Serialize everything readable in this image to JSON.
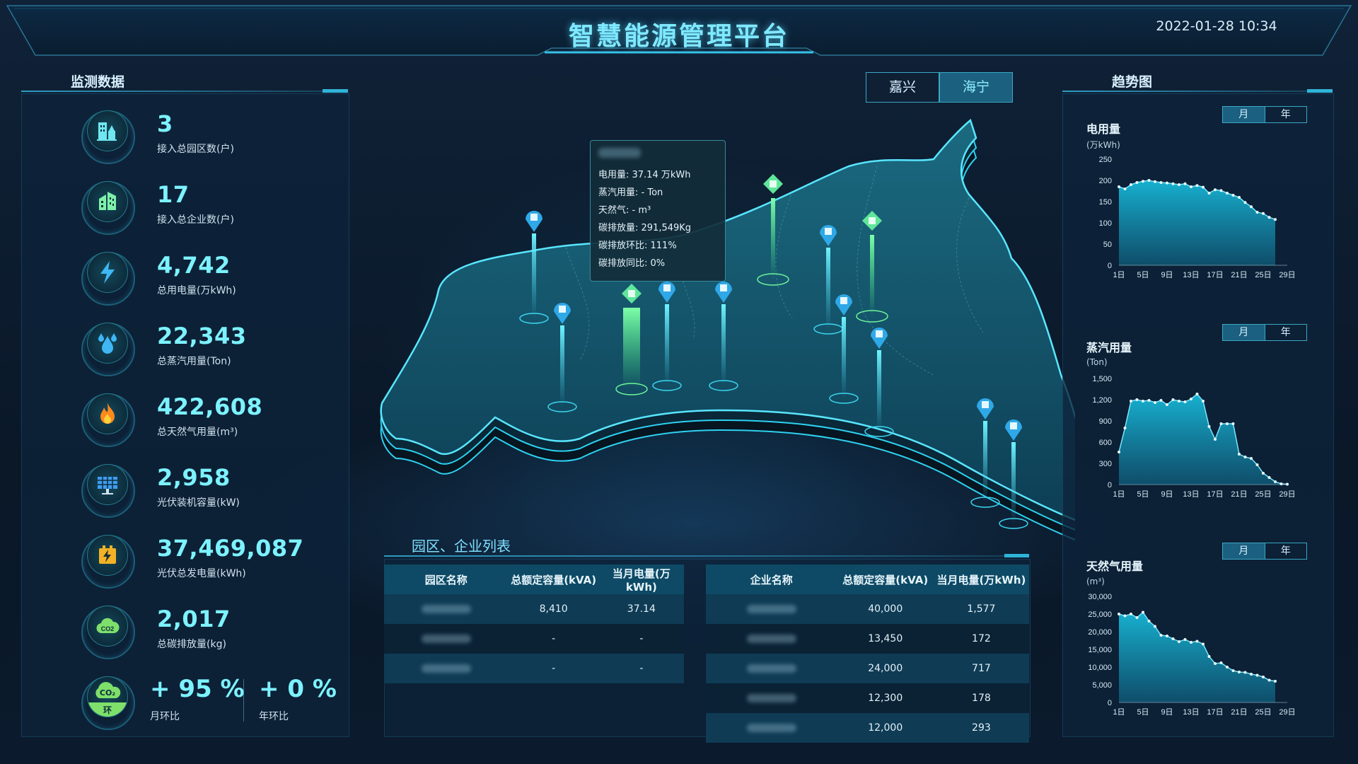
{
  "header": {
    "title": "智慧能源管理平台",
    "datetime": "2022-01-28 10:34"
  },
  "left_panel": {
    "title": "监测数据",
    "metrics": [
      {
        "value": "3",
        "label": "接入总园区数(户)",
        "icon": "building-icon"
      },
      {
        "value": "17",
        "label": "接入总企业数(户)",
        "icon": "enterprise-icon"
      },
      {
        "value": "4,742",
        "label": "总用电量(万kWh)",
        "icon": "lightning-icon"
      },
      {
        "value": "22,343",
        "label": "总蒸汽用量(Ton)",
        "icon": "water-drop-icon"
      },
      {
        "value": "422,608",
        "label": "总天然气用量(m³)",
        "icon": "flame-icon"
      },
      {
        "value": "2,958",
        "label": "光伏装机容量(kW)",
        "icon": "solar-panel-icon"
      },
      {
        "value": "37,469,087",
        "label": "光伏总发电量(kWh)",
        "icon": "battery-charge-icon"
      },
      {
        "value": "2,017",
        "label": "总碳排放量(kg)",
        "icon": "co2-cloud-icon"
      }
    ],
    "ratios": {
      "icon_text_top": "CO₂",
      "icon_text_bottom": "环",
      "month_value": "+ 95 %",
      "month_label": "月环比",
      "year_value": "+ 0 %",
      "year_label": "年环比"
    }
  },
  "map": {
    "cities": [
      {
        "label": "嘉兴",
        "active": false
      },
      {
        "label": "海宁",
        "active": true
      }
    ],
    "tooltip": {
      "lines": [
        "电用量: 37.14 万kWh",
        "蒸汽用量: - Ton",
        "天然气: - m³",
        "碳排放量: 291,549Kg",
        "碳排放环比: 111%",
        "碳排放同比: 0%"
      ]
    }
  },
  "list": {
    "title": "园区、企业列表",
    "park_table": {
      "headers": [
        "园区名称",
        "总额定容量(kVA)",
        "当月电量(万kWh)"
      ],
      "rows": [
        [
          "",
          "8,410",
          "37.14"
        ],
        [
          "",
          "-",
          "-"
        ],
        [
          "",
          "-",
          "-"
        ]
      ]
    },
    "enterprise_table": {
      "headers": [
        "企业名称",
        "总额定容量(kVA)",
        "当月电量(万kWh)"
      ],
      "rows": [
        [
          "",
          "40,000",
          "1,577"
        ],
        [
          "",
          "13,450",
          "172"
        ],
        [
          "",
          "24,000",
          "717"
        ],
        [
          "",
          "12,300",
          "178"
        ],
        [
          "",
          "12,000",
          "293"
        ]
      ]
    }
  },
  "right_panel": {
    "title": "趋势图",
    "month_label": "月",
    "year_label": "年",
    "charts": [
      {
        "title": "电用量",
        "unit": "(万kWh)",
        "y_ticks": [
          "250",
          "200",
          "150",
          "100",
          "50",
          "0"
        ],
        "x_ticks": [
          "1日",
          "5日",
          "9日",
          "13日",
          "17日",
          "21日",
          "25日",
          "29日"
        ]
      },
      {
        "title": "蒸汽用量",
        "unit": "(Ton)",
        "y_ticks": [
          "1,500",
          "1,200",
          "900",
          "600",
          "300",
          "0"
        ],
        "x_ticks": [
          "1日",
          "5日",
          "9日",
          "13日",
          "17日",
          "21日",
          "25日",
          "29日"
        ]
      },
      {
        "title": "天然气用量",
        "unit": "(m³)",
        "y_ticks": [
          "30,000",
          "25,000",
          "20,000",
          "15,000",
          "10,000",
          "5,000",
          "0"
        ],
        "x_ticks": [
          "1日",
          "5日",
          "9日",
          "13日",
          "17日",
          "21日",
          "25日",
          "29日"
        ]
      }
    ]
  },
  "chart_data": [
    {
      "type": "area",
      "title": "电用量",
      "ylabel": "(万kWh)",
      "x": [
        1,
        2,
        3,
        4,
        5,
        6,
        7,
        8,
        9,
        10,
        11,
        12,
        13,
        14,
        15,
        16,
        17,
        18,
        19,
        20,
        21,
        22,
        23,
        24,
        25,
        26,
        27
      ],
      "values": [
        185,
        180,
        190,
        195,
        198,
        200,
        197,
        195,
        194,
        192,
        190,
        192,
        185,
        188,
        184,
        170,
        178,
        176,
        170,
        165,
        160,
        148,
        138,
        125,
        122,
        113,
        108
      ],
      "ylim": [
        0,
        250
      ]
    },
    {
      "type": "area",
      "title": "蒸汽用量",
      "ylabel": "(Ton)",
      "x": [
        1,
        2,
        3,
        4,
        5,
        6,
        7,
        8,
        9,
        10,
        11,
        12,
        13,
        14,
        15,
        16,
        17,
        18,
        19,
        20,
        21,
        22,
        23,
        24,
        25,
        26,
        27,
        28,
        29
      ],
      "values": [
        460,
        800,
        1180,
        1200,
        1180,
        1190,
        1160,
        1190,
        1130,
        1200,
        1180,
        1170,
        1210,
        1280,
        1180,
        820,
        640,
        860,
        860,
        860,
        430,
        390,
        370,
        280,
        160,
        100,
        40,
        10,
        5
      ],
      "ylim": [
        0,
        1500
      ]
    },
    {
      "type": "area",
      "title": "天然气用量",
      "ylabel": "(m³)",
      "x": [
        1,
        2,
        3,
        4,
        5,
        6,
        7,
        8,
        9,
        10,
        11,
        12,
        13,
        14,
        15,
        16,
        17,
        18,
        19,
        20,
        21,
        22,
        23,
        24,
        25,
        26,
        27
      ],
      "values": [
        25000,
        24500,
        25000,
        24000,
        25500,
        23000,
        21500,
        19000,
        18800,
        18000,
        17200,
        17800,
        17000,
        17300,
        16500,
        13000,
        11000,
        11200,
        10000,
        9000,
        8600,
        8500,
        8000,
        7700,
        7200,
        6300,
        6000
      ],
      "ylim": [
        0,
        30000
      ]
    }
  ]
}
